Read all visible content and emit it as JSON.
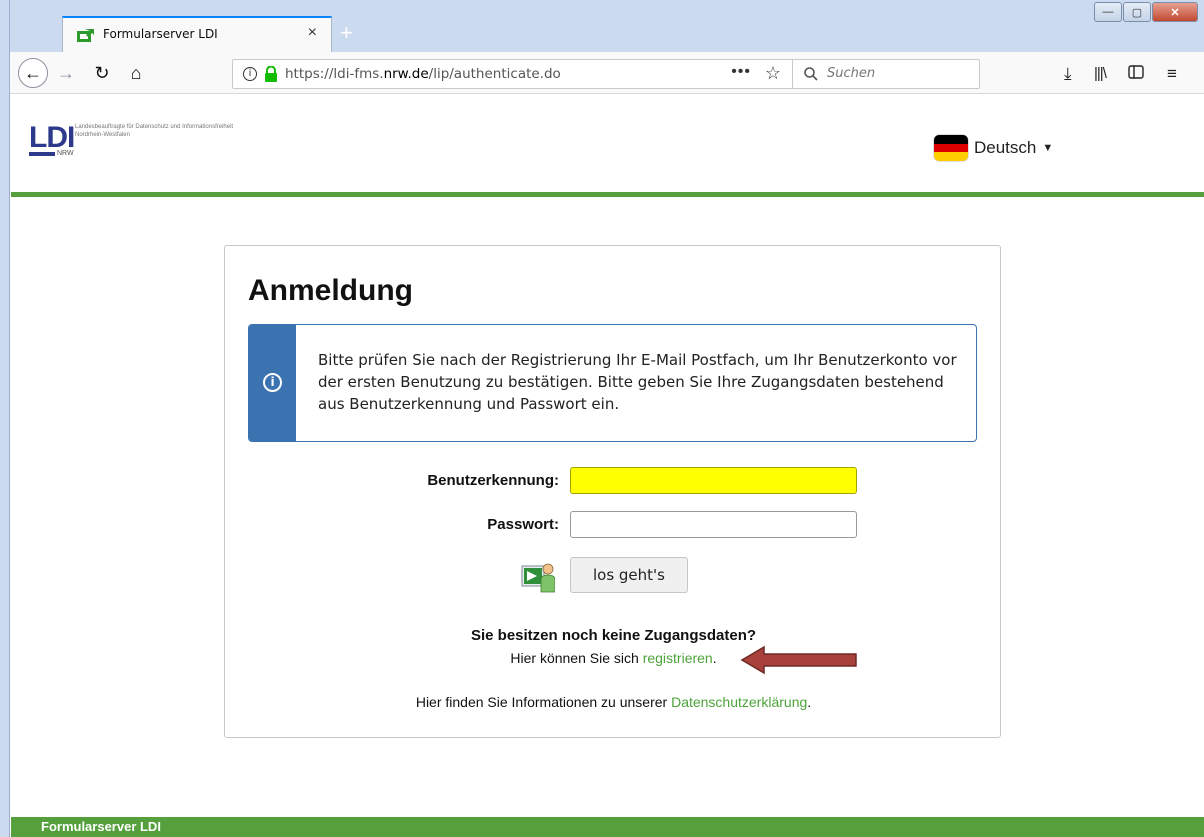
{
  "browser": {
    "tab_title": "Formularserver LDI",
    "tab_close": "×",
    "new_tab": "+",
    "window_controls": {
      "minimize": "—",
      "maximize": "▢",
      "close": "✕"
    },
    "url_prefix": "https://ldi-fms.",
    "url_domain": "nrw.de",
    "url_path": "/lip/authenticate.do",
    "url_more": "•••",
    "bookmark_star": "☆",
    "search_placeholder": "Suchen",
    "nav_icons": {
      "back": "back-arrow-icon",
      "forward": "forward-arrow-icon",
      "reload": "reload-icon",
      "home": "home-icon"
    },
    "toolbar_icons": [
      "download-icon",
      "library-icon",
      "sidebar-icon",
      "menu-icon"
    ],
    "accent_color": "#0a84ff"
  },
  "site": {
    "logo_text": "LDI",
    "logo_nrw": "NRW",
    "logo_subtitle": "Landesbeauftragte für Datenschutz und Informationsfreiheit Nordrhein-Westfalen",
    "language": "Deutsch",
    "brand_color": "#55a03c"
  },
  "login": {
    "title": "Anmeldung",
    "info_text": "Bitte prüfen Sie nach der Registrierung Ihr E-Mail Postfach, um Ihr Benutzerkonto vor der ersten Benutzung zu bestätigen. Bitte geben Sie Ihre Zugangsdaten bestehend aus Benutzerkennung und Passwort ein.",
    "username_label": "Benutzerkennung:",
    "username_value": "",
    "password_label": "Passwort:",
    "password_value": "",
    "submit_label": "los geht's",
    "no_access_title": "Sie besitzen noch keine Zugangsdaten?",
    "register_prefix": "Hier können Sie sich ",
    "register_link": "registrieren",
    "register_suffix": ".",
    "privacy_prefix": "Hier finden Sie Informationen zu unserer ",
    "privacy_link": "Datenschutzerklärung",
    "privacy_suffix": "."
  },
  "footer": {
    "text": "Formularserver LDI"
  }
}
